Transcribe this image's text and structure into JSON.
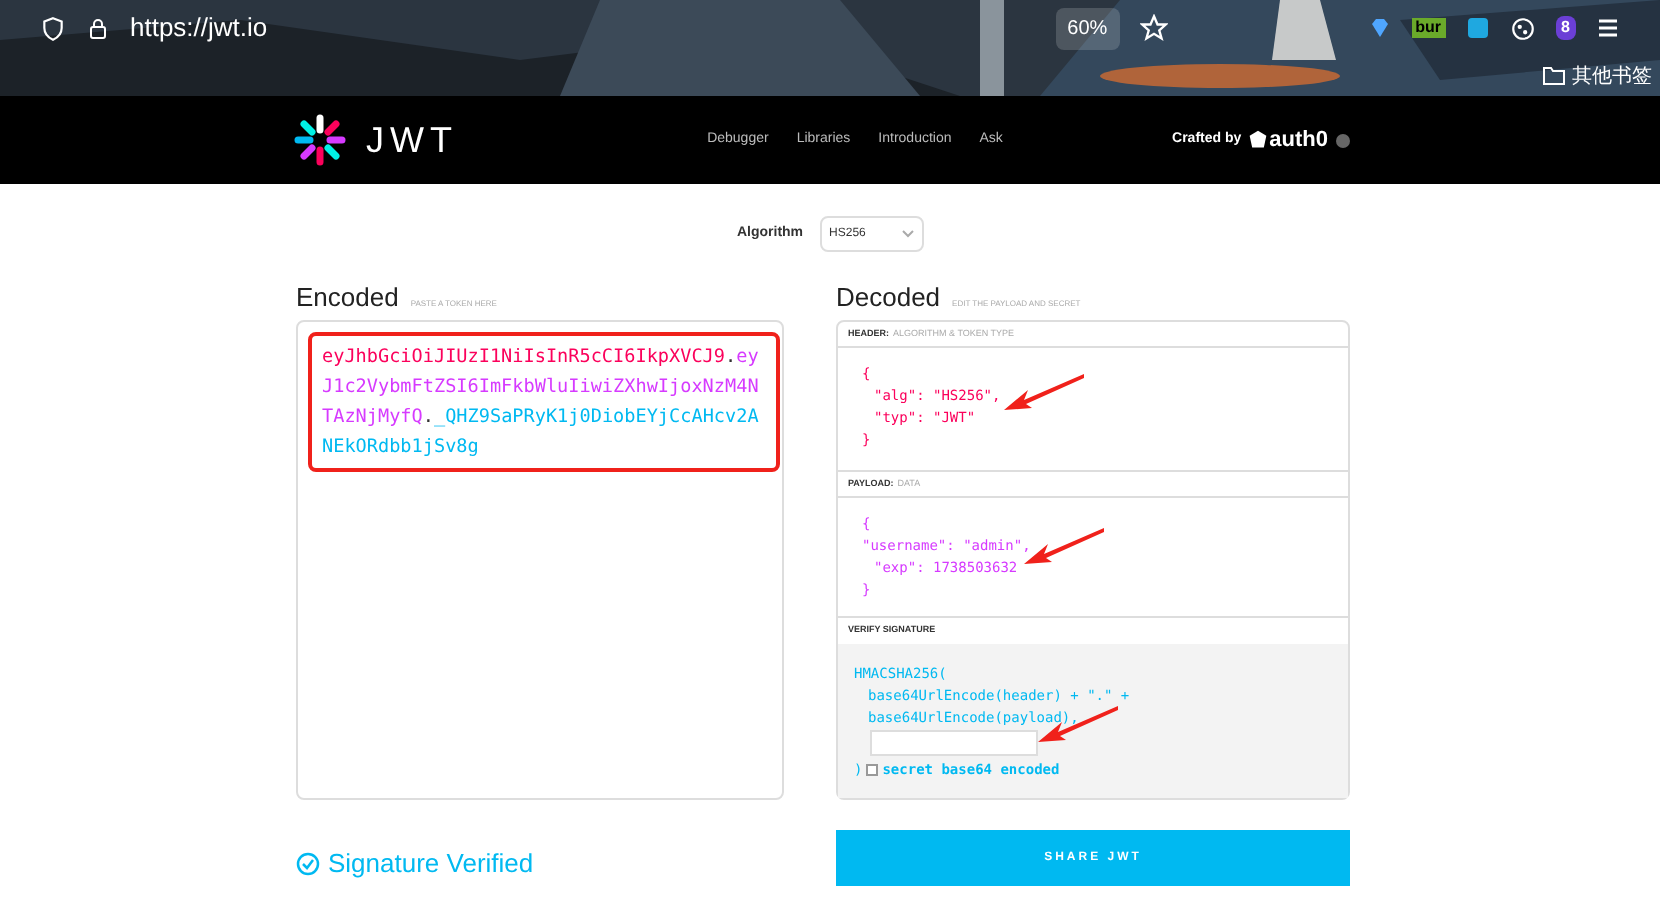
{
  "browser": {
    "url": "https://jwt.io",
    "zoom": "60%",
    "extension_badges": [
      "bur",
      "8"
    ],
    "bookmark_folder": "其他书签"
  },
  "nav": {
    "logo": "JWT",
    "links": [
      "Debugger",
      "Libraries",
      "Introduction",
      "Ask"
    ],
    "crafted_by": "Crafted by",
    "brand": "auth0"
  },
  "algorithm": {
    "label": "Algorithm",
    "value": "HS256"
  },
  "encoded": {
    "title": "Encoded",
    "hint": "PASTE A TOKEN HERE",
    "token_parts": [
      {
        "kind": "segment",
        "text": "eyJhbGciOiJIUzI1NiIsInR5cCI6IkpXVCJ9",
        "color": "#fb015b"
      },
      {
        "kind": "separator",
        "text": "."
      },
      {
        "kind": "segment",
        "text": "eyJ1c2VybmFtZSI6ImFkbWluIiwiZXhwIjoxNzM4NTAzNjMyfQ",
        "color": "#d63aff"
      },
      {
        "kind": "separator",
        "text": "."
      },
      {
        "kind": "segment",
        "text": "_QHZ9SaPRyK1j0DiobEYjCcAHcv2ANEkORdbb1jSv8g",
        "color": "#00b9f1"
      }
    ]
  },
  "status": "Signature Verified",
  "decoded": {
    "title": "Decoded",
    "hint": "EDIT THE PAYLOAD AND SECRET",
    "header": {
      "label": "HEADER:",
      "sub": "ALGORITHM & TOKEN TYPE",
      "lines": [
        "{",
        "\"alg\": \"HS256\",",
        "\"typ\": \"JWT\"",
        "}"
      ]
    },
    "payload": {
      "label": "PAYLOAD:",
      "sub": "DATA",
      "lines": [
        "{",
        "\"username\": \"admin\",",
        "\"exp\": 1738503632",
        "}"
      ]
    },
    "signature": {
      "label": "VERIFY SIGNATURE",
      "lines": [
        "HMACSHA256(",
        "base64UrlEncode(header) + \".\" +",
        "base64UrlEncode(payload),"
      ],
      "close": ")",
      "checkbox": {
        "label": "secret base64 encoded",
        "checked": false
      }
    }
  },
  "share_button": "SHARE JWT"
}
